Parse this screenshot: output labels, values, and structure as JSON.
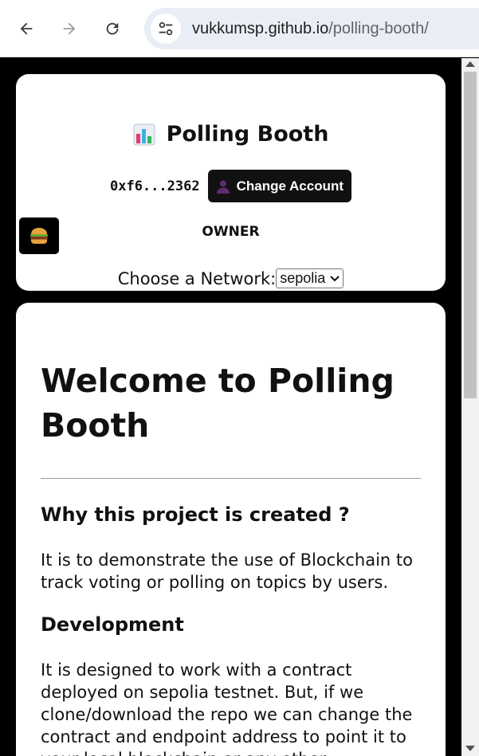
{
  "browser": {
    "url_host": "vukkumsp.github.io",
    "url_path": "/polling-booth/"
  },
  "header": {
    "title": "Polling Booth",
    "account_address": "0xf6...2362",
    "change_account_label": "Change Account",
    "role": "OWNER",
    "network_label": "Choose a Network:",
    "network_selected": "sepolia"
  },
  "content": {
    "heading": "Welcome to Polling Booth",
    "section1_title": "Why this project is created ?",
    "section1_text": "It is to demonstrate the use of Blockchain to track voting or polling on topics by users.",
    "section2_title": "Development",
    "section2_text": "It is designed to work with a contract deployed on sepolia testnet. But, if we clone/download the repo we can change the contract and endpoint address to point it to your local blockchain or any other"
  },
  "icons": {
    "back": "arrow-left-icon",
    "forward": "arrow-right-icon",
    "reload": "reload-icon",
    "site_info": "tune-icon",
    "brand": "bar-chart-icon",
    "user": "user-silhouette-icon",
    "menu": "hamburger-emoji-icon",
    "select_caret": "chevron-down-icon"
  }
}
